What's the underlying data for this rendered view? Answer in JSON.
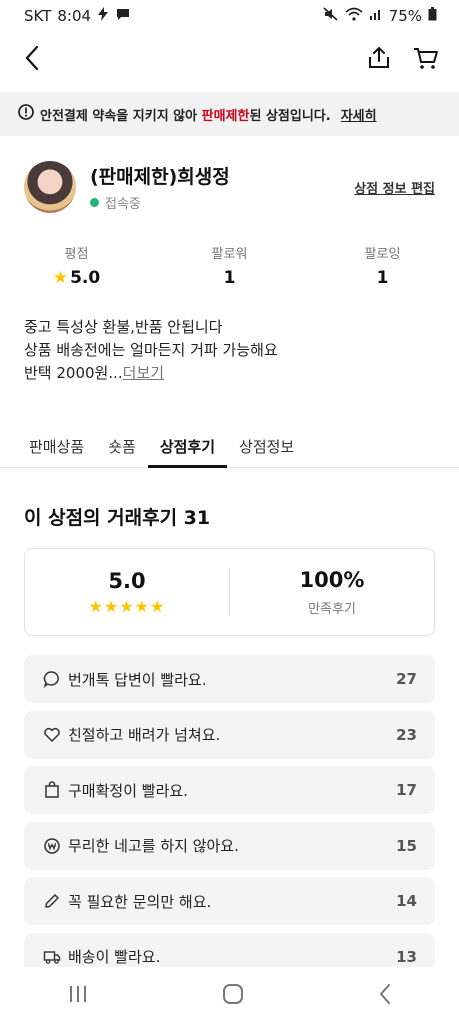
{
  "status_bar": {
    "carrier": "SKT",
    "time": "8:04",
    "battery": "75%"
  },
  "header": {
    "back_icon": "chevron-left-icon",
    "share_icon": "share-icon",
    "cart_icon": "cart-icon"
  },
  "notice": {
    "prefix": "안전결제 약속을 지키지 않아",
    "highlight": "판매제한",
    "suffix": "된 상점입니다.",
    "link": "자세히",
    "highlight_color": "#d0021b"
  },
  "profile": {
    "name": "(판매제한)희생정",
    "status": "접속중",
    "status_color": "#22b573",
    "edit_label": "상점 정보 편집"
  },
  "stats": [
    {
      "label": "평점",
      "value": "5.0"
    },
    {
      "label": "팔로워",
      "value": "1"
    },
    {
      "label": "팔로잉",
      "value": "1"
    }
  ],
  "description": {
    "lines": [
      "중고 특성상 환불,반품 안됩니다",
      "상품 배송전에는 얼마든지 거파 가능해요",
      "반택 2000원..."
    ],
    "more_label": "더보기"
  },
  "tabs": [
    {
      "label": "판매상품"
    },
    {
      "label": "숏폼"
    },
    {
      "label": "상점후기",
      "active": true
    },
    {
      "label": "상점정보"
    }
  ],
  "reviews": {
    "title": "이 상점의 거래후기 31",
    "rating": "5.0",
    "stars": "★★★★★",
    "satisfaction": "100%",
    "satisfaction_label": "만족후기",
    "items": [
      {
        "icon": "chat-bubble-icon",
        "text": "번개톡 답변이 빨라요.",
        "count": "27"
      },
      {
        "icon": "heart-icon",
        "text": "친절하고 배려가 넘쳐요.",
        "count": "23"
      },
      {
        "icon": "shopping-bag-icon",
        "text": "구매확정이 빨라요.",
        "count": "17"
      },
      {
        "icon": "won-coin-icon",
        "text": "무리한 네고를 하지 않아요.",
        "count": "15"
      },
      {
        "icon": "pencil-icon",
        "text": "꼭 필요한 문의만 해요.",
        "count": "14"
      },
      {
        "icon": "truck-icon",
        "text": "배송이 빨라요.",
        "count": "13"
      }
    ]
  },
  "nav": {
    "recent_icon": "recent-apps-icon",
    "home_icon": "home-icon",
    "back_icon": "back-icon"
  }
}
